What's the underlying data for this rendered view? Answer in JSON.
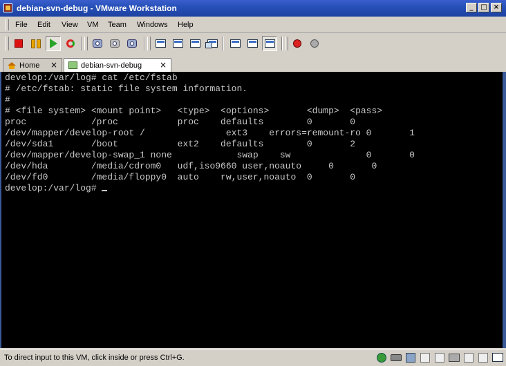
{
  "window": {
    "title": "debian-svn-debug - VMware Workstation",
    "controls": [
      "_",
      "□",
      "×"
    ]
  },
  "menu": {
    "items": [
      "File",
      "Edit",
      "View",
      "VM",
      "Team",
      "Windows",
      "Help"
    ]
  },
  "toolbar": {
    "buttons": [
      "power-off-icon",
      "suspend-icon",
      "power-on-icon",
      "reset-icon",
      "snapshot-icon",
      "revert-snapshot-icon",
      "snapshot-manager-icon",
      "quick-switch-icon",
      "full-screen-icon",
      "fit-window-icon",
      "unity-icon",
      "summary-view-icon",
      "appliance-view-icon",
      "console-view-icon",
      "record-icon",
      "replay-icon"
    ]
  },
  "tabs": [
    {
      "label": "Home",
      "close": "×"
    },
    {
      "label": "debian-svn-debug",
      "close": "×"
    }
  ],
  "console": {
    "lines": [
      "develop:/var/log# cat /etc/fstab",
      "# /etc/fstab: static file system information.",
      "#",
      "# <file system> <mount point>   <type>  <options>       <dump>  <pass>",
      "proc            /proc           proc    defaults        0       0",
      "/dev/mapper/develop-root /               ext3    errors=remount-ro 0       1",
      "/dev/sda1       /boot           ext2    defaults        0       2",
      "/dev/mapper/develop-swap_1 none            swap    sw              0       0",
      "/dev/hda        /media/cdrom0   udf,iso9660 user,noauto     0       0",
      "/dev/fd0        /media/floppy0  auto    rw,user,noauto  0       0"
    ],
    "prompt": "develop:/var/log# "
  },
  "status": {
    "text": "To direct input to this VM, click inside or press Ctrl+G.",
    "icons": [
      "network-icon",
      "hard-disk-icon",
      "floppy-icon",
      "cdrom-icon",
      "usb-icon",
      "printer-icon",
      "sound-icon",
      "display-icon"
    ]
  },
  "colors": {
    "title_bar": "#2750b8",
    "console_bg": "#000000",
    "console_fg": "#c8c8c8",
    "chrome": "#d4d0c8"
  }
}
